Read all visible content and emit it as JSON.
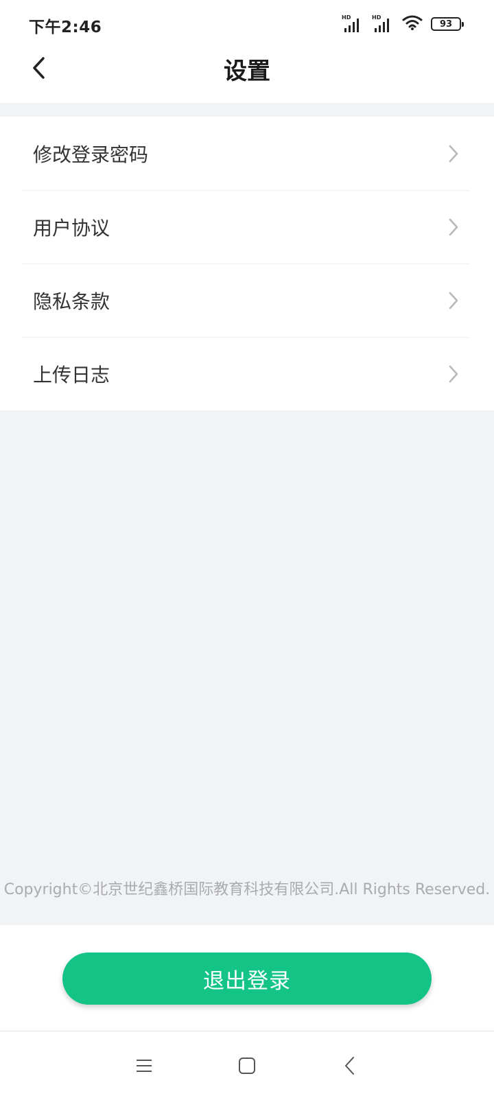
{
  "status_bar": {
    "time": "下午2:46",
    "signal_1_label": "HD",
    "signal_2_label": "HD",
    "battery_level": "93",
    "icons": [
      "signal-hd-icon",
      "signal-hd-icon",
      "wifi-icon",
      "battery-icon"
    ]
  },
  "header": {
    "title": "设置",
    "back_icon": "chevron-left-icon"
  },
  "menu": {
    "items": [
      {
        "label": "修改登录密码",
        "icon": "chevron-right-icon"
      },
      {
        "label": "用户协议",
        "icon": "chevron-right-icon"
      },
      {
        "label": "隐私条款",
        "icon": "chevron-right-icon"
      },
      {
        "label": "上传日志",
        "icon": "chevron-right-icon"
      }
    ]
  },
  "footer": {
    "copyright": "Copyright©北京世纪鑫桥国际教育科技有限公司.All Rights Reserved.",
    "logout_label": "退出登录"
  },
  "nav_bar": {
    "icons": [
      "menu-icon",
      "home-icon",
      "back-icon"
    ]
  },
  "colors": {
    "accent": "#13c486",
    "background": "#f2f3f5",
    "text": "#333333",
    "muted": "#a9abb0"
  }
}
